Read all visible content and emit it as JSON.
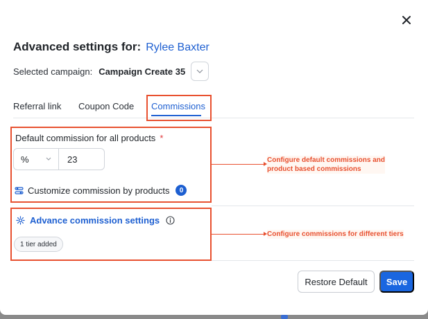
{
  "modal": {
    "title_prefix": "Advanced settings for:",
    "affiliate_name": "Rylee Baxter",
    "campaign_label": "Selected campaign:",
    "campaign_value": "Campaign Create 35"
  },
  "tabs": [
    {
      "label": "Referral link",
      "active": false
    },
    {
      "label": "Coupon Code",
      "active": false
    },
    {
      "label": "Commissions",
      "active": true
    }
  ],
  "commission": {
    "default_label": "Default commission for all products",
    "required_mark": "*",
    "unit": "%",
    "amount": "23",
    "customize_label": "Customize commission by products",
    "customize_count": "0"
  },
  "advanced": {
    "label": "Advance commission settings",
    "tiers_chip": "1 tier added"
  },
  "annotations": {
    "default_note_line1": "Configure default commissions and",
    "default_note_line2": "product based commissions",
    "tiers_note": "Configure commissions for different tiers"
  },
  "footer": {
    "restore_label": "Restore Default",
    "save_label": "Save"
  },
  "colors": {
    "accent": "#1d5fd1",
    "primary_button": "#1a66e0",
    "annotation": "#e8502f",
    "required": "#e0373a"
  }
}
